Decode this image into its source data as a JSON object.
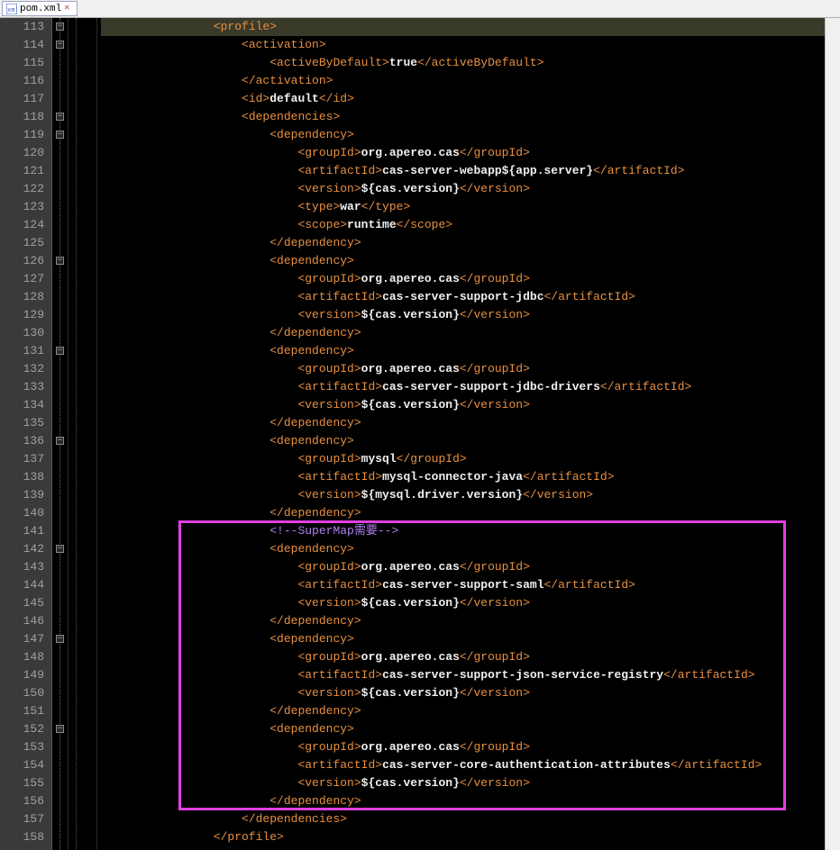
{
  "tab": {
    "filename": "pom.xml"
  },
  "startLine": 113,
  "lines": [
    {
      "indent": 4,
      "segs": [
        {
          "t": "tag",
          "v": "<profile>"
        }
      ],
      "fold": "open",
      "hl": true
    },
    {
      "indent": 5,
      "segs": [
        {
          "t": "tag",
          "v": "<activation>"
        }
      ],
      "fold": "open"
    },
    {
      "indent": 6,
      "segs": [
        {
          "t": "tag",
          "v": "<activeByDefault>"
        },
        {
          "t": "txt",
          "v": "true"
        },
        {
          "t": "tag",
          "v": "</activeByDefault>"
        }
      ]
    },
    {
      "indent": 5,
      "segs": [
        {
          "t": "tag",
          "v": "</activation>"
        }
      ]
    },
    {
      "indent": 5,
      "segs": [
        {
          "t": "tag",
          "v": "<id>"
        },
        {
          "t": "txt",
          "v": "default"
        },
        {
          "t": "tag",
          "v": "</id>"
        }
      ]
    },
    {
      "indent": 5,
      "segs": [
        {
          "t": "tag",
          "v": "<dependencies>"
        }
      ],
      "fold": "open"
    },
    {
      "indent": 6,
      "segs": [
        {
          "t": "tag",
          "v": "<dependency>"
        }
      ],
      "fold": "open"
    },
    {
      "indent": 7,
      "segs": [
        {
          "t": "tag",
          "v": "<groupId>"
        },
        {
          "t": "txt",
          "v": "org.apereo.cas"
        },
        {
          "t": "tag",
          "v": "</groupId>"
        }
      ]
    },
    {
      "indent": 7,
      "segs": [
        {
          "t": "tag",
          "v": "<artifactId>"
        },
        {
          "t": "txt",
          "v": "cas-server-webapp${app.server}"
        },
        {
          "t": "tag",
          "v": "</artifactId>"
        }
      ]
    },
    {
      "indent": 7,
      "segs": [
        {
          "t": "tag",
          "v": "<version>"
        },
        {
          "t": "txt",
          "v": "${cas.version}"
        },
        {
          "t": "tag",
          "v": "</version>"
        }
      ]
    },
    {
      "indent": 7,
      "segs": [
        {
          "t": "tag",
          "v": "<type>"
        },
        {
          "t": "txt",
          "v": "war"
        },
        {
          "t": "tag",
          "v": "</type>"
        }
      ]
    },
    {
      "indent": 7,
      "segs": [
        {
          "t": "tag",
          "v": "<scope>"
        },
        {
          "t": "txt",
          "v": "runtime"
        },
        {
          "t": "tag",
          "v": "</scope>"
        }
      ]
    },
    {
      "indent": 6,
      "segs": [
        {
          "t": "tag",
          "v": "</dependency>"
        }
      ]
    },
    {
      "indent": 6,
      "segs": [
        {
          "t": "tag",
          "v": "<dependency>"
        }
      ],
      "fold": "open"
    },
    {
      "indent": 7,
      "segs": [
        {
          "t": "tag",
          "v": "<groupId>"
        },
        {
          "t": "txt",
          "v": "org.apereo.cas"
        },
        {
          "t": "tag",
          "v": "</groupId>"
        }
      ]
    },
    {
      "indent": 7,
      "segs": [
        {
          "t": "tag",
          "v": "<artifactId>"
        },
        {
          "t": "txt",
          "v": "cas-server-support-jdbc"
        },
        {
          "t": "tag",
          "v": "</artifactId>"
        }
      ]
    },
    {
      "indent": 7,
      "segs": [
        {
          "t": "tag",
          "v": "<version>"
        },
        {
          "t": "txt",
          "v": "${cas.version}"
        },
        {
          "t": "tag",
          "v": "</version>"
        }
      ]
    },
    {
      "indent": 6,
      "segs": [
        {
          "t": "tag",
          "v": "</dependency>"
        }
      ]
    },
    {
      "indent": 6,
      "segs": [
        {
          "t": "tag",
          "v": "<dependency>"
        }
      ],
      "fold": "open"
    },
    {
      "indent": 7,
      "segs": [
        {
          "t": "tag",
          "v": "<groupId>"
        },
        {
          "t": "txt",
          "v": "org.apereo.cas"
        },
        {
          "t": "tag",
          "v": "</groupId>"
        }
      ]
    },
    {
      "indent": 7,
      "segs": [
        {
          "t": "tag",
          "v": "<artifactId>"
        },
        {
          "t": "txt",
          "v": "cas-server-support-jdbc-drivers"
        },
        {
          "t": "tag",
          "v": "</artifactId>"
        }
      ]
    },
    {
      "indent": 7,
      "segs": [
        {
          "t": "tag",
          "v": "<version>"
        },
        {
          "t": "txt",
          "v": "${cas.version}"
        },
        {
          "t": "tag",
          "v": "</version>"
        }
      ]
    },
    {
      "indent": 6,
      "segs": [
        {
          "t": "tag",
          "v": "</dependency>"
        }
      ]
    },
    {
      "indent": 6,
      "segs": [
        {
          "t": "tag",
          "v": "<dependency>"
        }
      ],
      "fold": "open"
    },
    {
      "indent": 7,
      "segs": [
        {
          "t": "tag",
          "v": "<groupId>"
        },
        {
          "t": "txt",
          "v": "mysql"
        },
        {
          "t": "tag",
          "v": "</groupId>"
        }
      ]
    },
    {
      "indent": 7,
      "segs": [
        {
          "t": "tag",
          "v": "<artifactId>"
        },
        {
          "t": "txt",
          "v": "mysql-connector-java"
        },
        {
          "t": "tag",
          "v": "</artifactId>"
        }
      ]
    },
    {
      "indent": 7,
      "segs": [
        {
          "t": "tag",
          "v": "<version>"
        },
        {
          "t": "txt",
          "v": "${mysql.driver.version}"
        },
        {
          "t": "tag",
          "v": "</version>"
        }
      ]
    },
    {
      "indent": 6,
      "segs": [
        {
          "t": "tag",
          "v": "</dependency>"
        }
      ]
    },
    {
      "indent": 6,
      "segs": [
        {
          "t": "cmt",
          "v": "<!--SuperMap需要-->"
        }
      ]
    },
    {
      "indent": 6,
      "segs": [
        {
          "t": "tag",
          "v": "<dependency>"
        }
      ],
      "fold": "open"
    },
    {
      "indent": 7,
      "segs": [
        {
          "t": "tag",
          "v": "<groupId>"
        },
        {
          "t": "txt",
          "v": "org.apereo.cas"
        },
        {
          "t": "tag",
          "v": "</groupId>"
        }
      ]
    },
    {
      "indent": 7,
      "segs": [
        {
          "t": "tag",
          "v": "<artifactId>"
        },
        {
          "t": "txt",
          "v": "cas-server-support-saml"
        },
        {
          "t": "tag",
          "v": "</artifactId>"
        }
      ]
    },
    {
      "indent": 7,
      "segs": [
        {
          "t": "tag",
          "v": "<version>"
        },
        {
          "t": "txt",
          "v": "${cas.version}"
        },
        {
          "t": "tag",
          "v": "</version>"
        }
      ]
    },
    {
      "indent": 6,
      "segs": [
        {
          "t": "tag",
          "v": "</dependency>"
        }
      ]
    },
    {
      "indent": 6,
      "segs": [
        {
          "t": "tag",
          "v": "<dependency>"
        }
      ],
      "fold": "open"
    },
    {
      "indent": 7,
      "segs": [
        {
          "t": "tag",
          "v": "<groupId>"
        },
        {
          "t": "txt",
          "v": "org.apereo.cas"
        },
        {
          "t": "tag",
          "v": "</groupId>"
        }
      ]
    },
    {
      "indent": 7,
      "segs": [
        {
          "t": "tag",
          "v": "<artifactId>"
        },
        {
          "t": "txt",
          "v": "cas-server-support-json-service-registry"
        },
        {
          "t": "tag",
          "v": "</artifactId>"
        }
      ]
    },
    {
      "indent": 7,
      "segs": [
        {
          "t": "tag",
          "v": "<version>"
        },
        {
          "t": "txt",
          "v": "${cas.version}"
        },
        {
          "t": "tag",
          "v": "</version>"
        }
      ]
    },
    {
      "indent": 6,
      "segs": [
        {
          "t": "tag",
          "v": "</dependency>"
        }
      ]
    },
    {
      "indent": 6,
      "segs": [
        {
          "t": "tag",
          "v": "<dependency>"
        }
      ],
      "fold": "open"
    },
    {
      "indent": 7,
      "segs": [
        {
          "t": "tag",
          "v": "<groupId>"
        },
        {
          "t": "txt",
          "v": "org.apereo.cas"
        },
        {
          "t": "tag",
          "v": "</groupId>"
        }
      ]
    },
    {
      "indent": 7,
      "segs": [
        {
          "t": "tag",
          "v": "<artifactId>"
        },
        {
          "t": "txt",
          "v": "cas-server-core-authentication-attributes"
        },
        {
          "t": "tag",
          "v": "</artifactId>"
        }
      ]
    },
    {
      "indent": 7,
      "segs": [
        {
          "t": "tag",
          "v": "<version>"
        },
        {
          "t": "txt",
          "v": "${cas.version}"
        },
        {
          "t": "tag",
          "v": "</version>"
        }
      ]
    },
    {
      "indent": 6,
      "segs": [
        {
          "t": "tag",
          "v": "</dependency>"
        }
      ]
    },
    {
      "indent": 5,
      "segs": [
        {
          "t": "tag",
          "v": "</dependencies>"
        }
      ]
    },
    {
      "indent": 4,
      "segs": [
        {
          "t": "tag",
          "v": "</profile>"
        }
      ]
    }
  ],
  "highlight": {
    "startLine": 141,
    "endLine": 156
  }
}
